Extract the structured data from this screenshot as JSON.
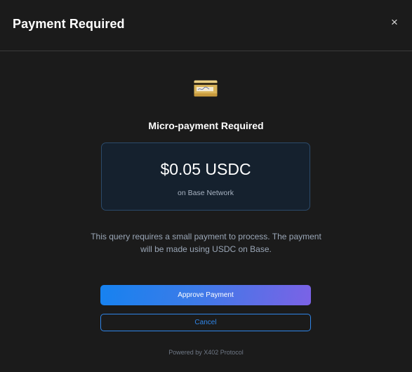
{
  "header": {
    "title": "Payment Required",
    "close_label": "×"
  },
  "icon": {
    "name": "credit-card-icon"
  },
  "main": {
    "subtitle": "Micro-payment Required",
    "amount": "$0.05 USDC",
    "network": "on Base Network",
    "description": "This query requires a small payment to process. The payment will be made using USDC on Base."
  },
  "actions": {
    "approve_label": "Approve Payment",
    "cancel_label": "Cancel"
  },
  "footer": {
    "text": "Powered by X402 Protocol"
  },
  "colors": {
    "background": "#1b1b1b",
    "accent": "#2f86ea",
    "gradient_start": "#1682f0",
    "gradient_end": "#7b62e6",
    "amount_box_bg": "#15212e"
  }
}
